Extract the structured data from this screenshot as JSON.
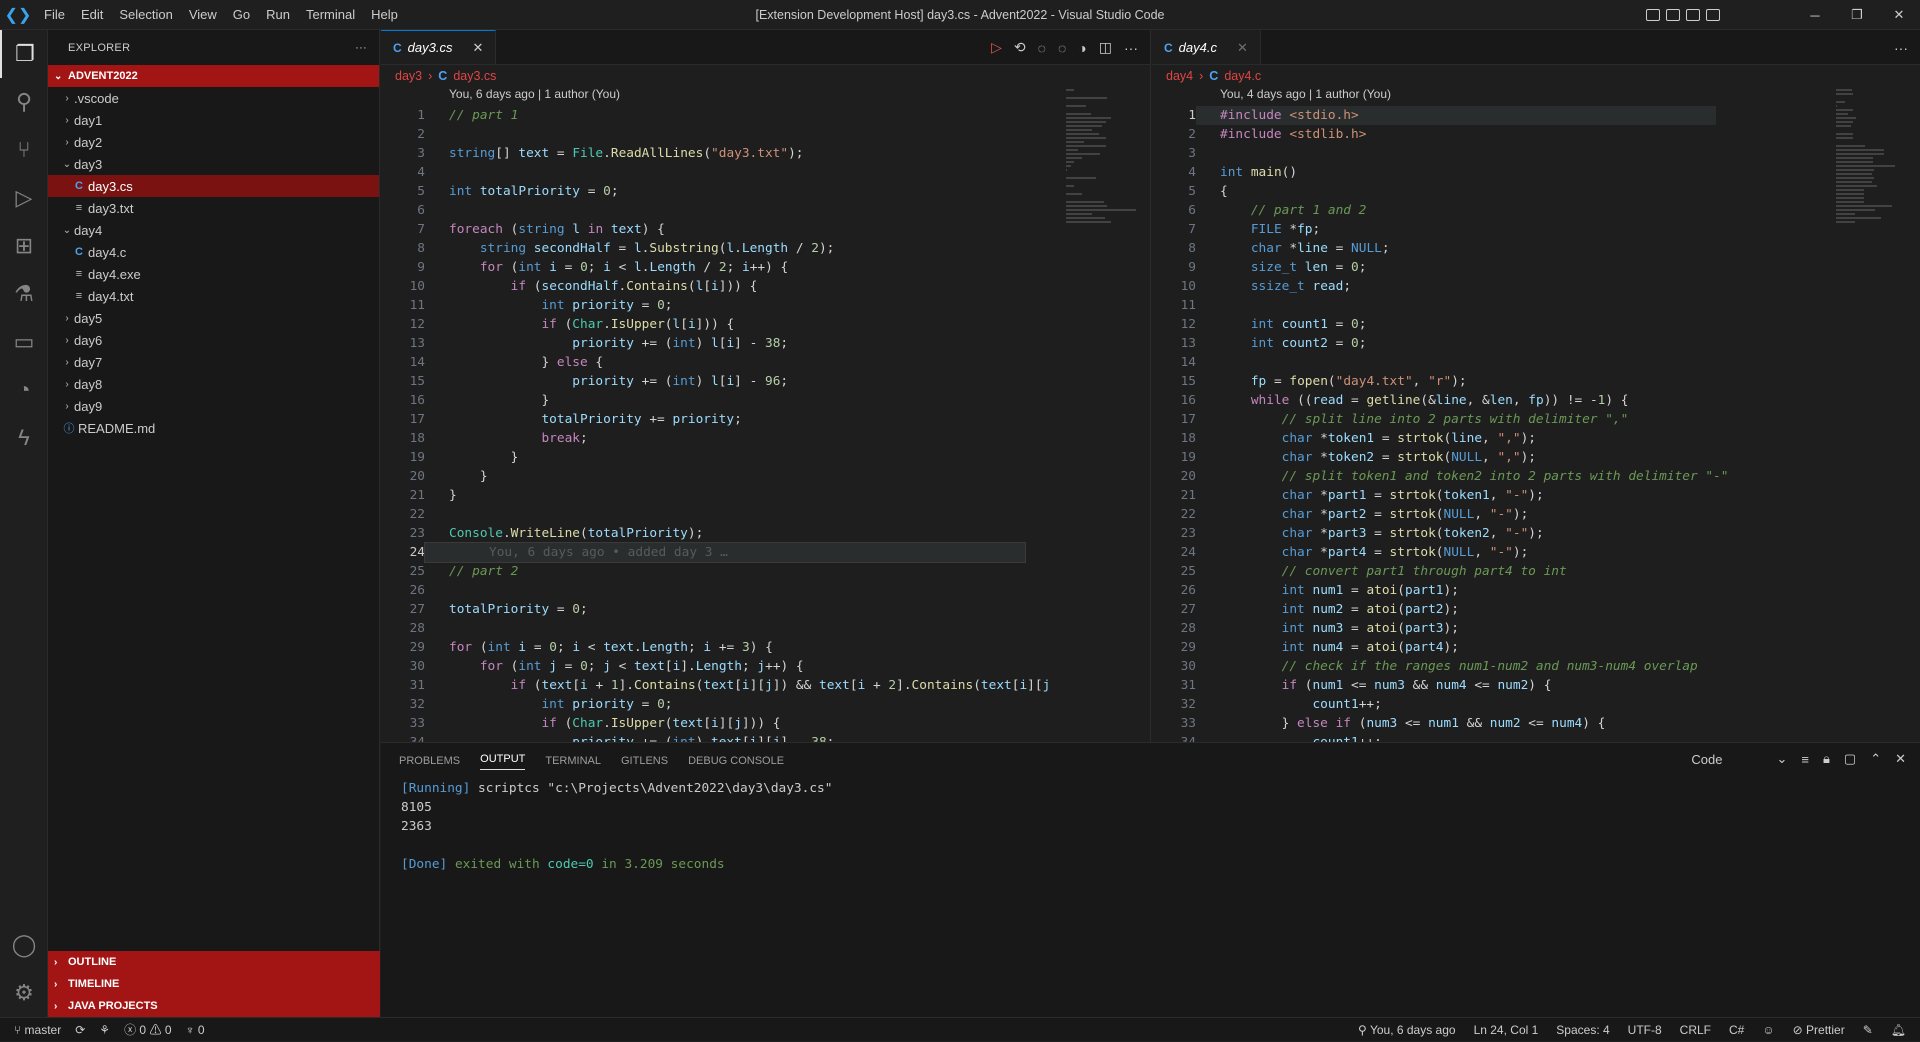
{
  "window": {
    "title": "[Extension Development Host] day3.cs - Advent2022 - Visual Studio Code",
    "menu": [
      "File",
      "Edit",
      "Selection",
      "View",
      "Go",
      "Run",
      "Terminal",
      "Help"
    ],
    "minimize": "─",
    "restore": "❐",
    "close": "✕"
  },
  "explorer": {
    "header": "EXPLORER",
    "more": "···",
    "root": "ADVENT2022",
    "items": [
      {
        "label": ".vscode",
        "type": "folder",
        "depth": 1,
        "open": false
      },
      {
        "label": "day1",
        "type": "folder",
        "depth": 1,
        "open": false
      },
      {
        "label": "day2",
        "type": "folder",
        "depth": 1,
        "open": false
      },
      {
        "label": "day3",
        "type": "folder",
        "depth": 1,
        "open": true
      },
      {
        "label": "day3.cs",
        "type": "cs",
        "depth": 2,
        "selected": true
      },
      {
        "label": "day3.txt",
        "type": "txt",
        "depth": 2
      },
      {
        "label": "day4",
        "type": "folder",
        "depth": 1,
        "open": true
      },
      {
        "label": "day4.c",
        "type": "c",
        "depth": 2
      },
      {
        "label": "day4.exe",
        "type": "txt",
        "depth": 2
      },
      {
        "label": "day4.txt",
        "type": "txt",
        "depth": 2
      },
      {
        "label": "day5",
        "type": "folder",
        "depth": 1,
        "open": false
      },
      {
        "label": "day6",
        "type": "folder",
        "depth": 1,
        "open": false
      },
      {
        "label": "day7",
        "type": "folder",
        "depth": 1,
        "open": false
      },
      {
        "label": "day8",
        "type": "folder",
        "depth": 1,
        "open": false
      },
      {
        "label": "day9",
        "type": "folder",
        "depth": 1,
        "open": false
      },
      {
        "label": "README.md",
        "type": "info",
        "depth": 1
      }
    ],
    "bottom_sections": [
      "OUTLINE",
      "TIMELINE",
      "JAVA PROJECTS"
    ]
  },
  "left_editor": {
    "tab": "day3.cs",
    "tab_icon": "C",
    "breadcrumb": [
      "day3",
      "day3.cs"
    ],
    "blame": "You, 6 days ago | 1 author (You)",
    "current_line": 24,
    "inline_blame": "You, 6 days ago • added day 3 …",
    "lines": [
      "// part 1",
      "",
      "string[] text = File.ReadAllLines(\"day3.txt\");",
      "",
      "int totalPriority = 0;",
      "",
      "foreach (string l in text) {",
      "    string secondHalf = l.Substring(l.Length / 2);",
      "    for (int i = 0; i < l.Length / 2; i++) {",
      "        if (secondHalf.Contains(l[i])) {",
      "            int priority = 0;",
      "            if (Char.IsUpper(l[i])) {",
      "                priority += (int) l[i] - 38;",
      "            } else {",
      "                priority += (int) l[i] - 96;",
      "            }",
      "            totalPriority += priority;",
      "            break;",
      "        }",
      "    }",
      "}",
      "",
      "Console.WriteLine(totalPriority);",
      "",
      "// part 2",
      "",
      "totalPriority = 0;",
      "",
      "for (int i = 0; i < text.Length; i += 3) {",
      "    for (int j = 0; j < text[i].Length; j++) {",
      "        if (text[i + 1].Contains(text[i][j]) && text[i + 2].Contains(text[i][j",
      "            int priority = 0;",
      "            if (Char.IsUpper(text[i][j])) {",
      "                priority += (int) text[i][j] - 38;"
    ]
  },
  "right_editor": {
    "tab": "day4.c",
    "tab_icon": "C",
    "breadcrumb": [
      "day4",
      "day4.c"
    ],
    "blame": "You, 4 days ago | 1 author (You)",
    "current_line": 1,
    "lines": [
      "#include <stdio.h>",
      "#include <stdlib.h>",
      "",
      "int main()",
      "{",
      "    // part 1 and 2",
      "    FILE *fp;",
      "    char *line = NULL;",
      "    size_t len = 0;",
      "    ssize_t read;",
      "",
      "    int count1 = 0;",
      "    int count2 = 0;",
      "",
      "    fp = fopen(\"day4.txt\", \"r\");",
      "    while ((read = getline(&line, &len, fp)) != -1) {",
      "        // split line into 2 parts with delimiter \",\"",
      "        char *token1 = strtok(line, \",\");",
      "        char *token2 = strtok(NULL, \",\");",
      "        // split token1 and token2 into 2 parts with delimiter \"-\"",
      "        char *part1 = strtok(token1, \"-\");",
      "        char *part2 = strtok(NULL, \"-\");",
      "        char *part3 = strtok(token2, \"-\");",
      "        char *part4 = strtok(NULL, \"-\");",
      "        // convert part1 through part4 to int",
      "        int num1 = atoi(part1);",
      "        int num2 = atoi(part2);",
      "        int num3 = atoi(part3);",
      "        int num4 = atoi(part4);",
      "        // check if the ranges num1-num2 and num3-num4 overlap",
      "        if (num1 <= num3 && num4 <= num2) {",
      "            count1++;",
      "        } else if (num3 <= num1 && num2 <= num4) {",
      "            count1++;"
    ]
  },
  "panel": {
    "tabs": [
      "PROBLEMS",
      "OUTPUT",
      "TERMINAL",
      "GITLENS",
      "DEBUG CONSOLE"
    ],
    "active_tab": "OUTPUT",
    "channel": "Code",
    "output": {
      "running_tag": "[Running]",
      "running_cmd": " scriptcs \"c:\\Projects\\Advent2022\\day3\\day3.cs\"",
      "result1": "8105",
      "result2": "2363",
      "done_tag": "[Done]",
      "done_text": " exited with ",
      "done_code": "code=0",
      "done_rest": " in 3.209 seconds"
    }
  },
  "status": {
    "branch": "master",
    "errors": "0",
    "warnings": "0",
    "ports": "0",
    "blame": "You, 6 days ago",
    "position": "Ln 24, Col 1",
    "spaces": "Spaces: 4",
    "encoding": "UTF-8",
    "eol": "CRLF",
    "language": "C#",
    "prettier": "Prettier"
  }
}
